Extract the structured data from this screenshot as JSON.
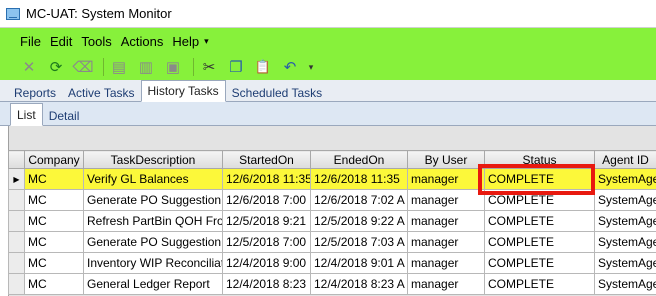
{
  "window": {
    "title": "MC-UAT: System Monitor"
  },
  "menu": {
    "items": [
      "File",
      "Edit",
      "Tools",
      "Actions",
      "Help",
      "▾"
    ]
  },
  "toolbar": {
    "buttons": [
      {
        "name": "delete-icon",
        "glyph": "✕"
      },
      {
        "name": "refresh-icon",
        "glyph": "⟳"
      },
      {
        "name": "eraser-icon",
        "glyph": "⌫"
      },
      {
        "name": "print-icon",
        "glyph": "▤"
      },
      {
        "name": "print-preview-icon",
        "glyph": "▥"
      },
      {
        "name": "save-icon",
        "glyph": "▣"
      },
      {
        "name": "cut-icon",
        "glyph": "✂"
      },
      {
        "name": "copy-icon",
        "glyph": "❐"
      },
      {
        "name": "paste-icon",
        "glyph": "📋"
      },
      {
        "name": "undo-icon",
        "glyph": "↶"
      },
      {
        "name": "undo-dropdown-icon",
        "glyph": "▾"
      }
    ]
  },
  "tabs": [
    "Reports",
    "Active Tasks",
    "History Tasks",
    "Scheduled Tasks"
  ],
  "active_tab": "History Tasks",
  "subtabs": [
    "List",
    "Detail"
  ],
  "grid": {
    "columns": [
      "Company",
      "TaskDescription",
      "StartedOn",
      "EndedOn",
      "By User",
      "Status",
      "Agent ID"
    ],
    "rows": [
      [
        "MC",
        "Verify GL Balances",
        "12/6/2018 11:35",
        "12/6/2018 11:35",
        "manager",
        "COMPLETE",
        "SystemAgent"
      ],
      [
        "MC",
        "Generate PO Suggestion",
        "12/6/2018 7:00",
        "12/6/2018 7:02 A",
        "manager",
        "COMPLETE",
        "SystemAgent"
      ],
      [
        "MC",
        "Refresh PartBin QOH Fro",
        "12/5/2018 9:21",
        "12/5/2018 9:22 A",
        "manager",
        "COMPLETE",
        "SystemAgent"
      ],
      [
        "MC",
        "Generate PO Suggestion",
        "12/5/2018 7:00",
        "12/5/2018 7:03 A",
        "manager",
        "COMPLETE",
        "SystemAgent"
      ],
      [
        "MC",
        "Inventory WIP Reconciliati",
        "12/4/2018 9:00",
        "12/4/2018 9:01 A",
        "manager",
        "COMPLETE",
        "SystemAgent"
      ],
      [
        "MC",
        "General Ledger Report",
        "12/4/2018 8:23",
        "12/4/2018 8:23 A",
        "manager",
        "COMPLETE",
        "SystemAgent"
      ]
    ],
    "current_row_marker": "▶"
  },
  "colors": {
    "toolbar_green": "#87f13b",
    "selected_row": "#fcf83a",
    "annotation_red": "#e8190f"
  }
}
